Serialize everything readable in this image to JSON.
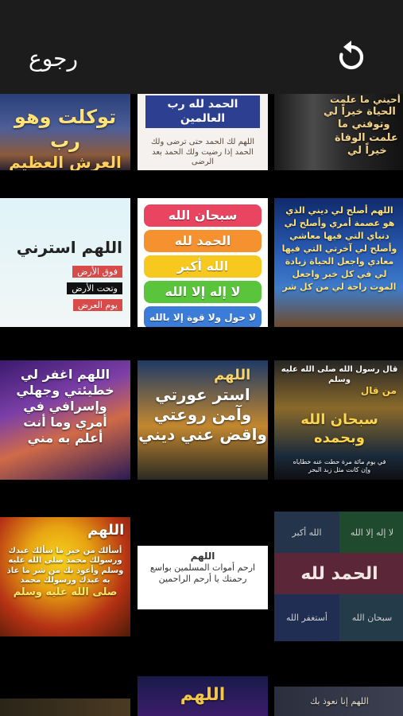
{
  "header": {
    "back_label": "رجوع",
    "refresh_icon": "refresh-icon"
  },
  "tiles": {
    "r0c0": {
      "line1": "توكلت وهو رب",
      "line2": "العرش العظيم"
    },
    "r0c1": {
      "title": "الحمد لله رب العالمين",
      "body": "اللهم لك الحمد حتى ترضى ولك الحمد إذا رضيت ولك الحمد بعد الرضى"
    },
    "r0c2": {
      "line1": "أحيني ما علمت",
      "line2": "الحياة خيراً لي",
      "line3": "وتوفني ما",
      "line4": "علمت الوفاة",
      "line5": "خيراً لي"
    },
    "r1c0": {
      "title": "اللهم استرني",
      "l1": "فوق الأرض",
      "l2": "وتحت الأرض",
      "l3": "يوم العرض"
    },
    "r1c1": {
      "p1": "سبحان الله",
      "p2": "الحمد لله",
      "p3": "الله أكبر",
      "p4": "لا إله إلا الله",
      "p5": "لا حول ولا قوة إلا بالله"
    },
    "r1c2": {
      "body": "اللهم أصلح لي ديني الذي هو عصمة أمري وأصلح لي دنياي التي فيها معاشي وأصلح لي آخرتي التي فيها معادي واجعل الحياة زيادة لي في كل خير واجعل الموت راحة لي من كل شر"
    },
    "r2c0": {
      "l1": "اللهم اغفر لي",
      "l2": "خطيئتي وجهلي",
      "l3": "وإسرافي في",
      "l4": "أمري وما أنت",
      "l5": "أعلم به مني"
    },
    "r2c1": {
      "l0": "اللهم",
      "l1": "استر عورتي",
      "l2": "وآمن روعتي",
      "l3": "واقض عني ديني"
    },
    "r2c2": {
      "l1": "قال رسول الله صلى الله عليه وسلم",
      "l2": "من قال",
      "l3": "سبحان الله وبحمده",
      "l4": "في يوم مائة مرة حطت عنه خطاياه",
      "l5": "وإن كانت مثل زبد البحر"
    },
    "r3c0": {
      "l0": "اللهم",
      "l1": "أسألك من خير ما سألك عبدك",
      "l2": "ورسولك محمد صلى الله عليه",
      "l3": "وسلم وأعوذ بك من شر ما عاذ",
      "l4": "به عبدك ورسولك محمد",
      "l5": "صلى الله عليه وسلم"
    },
    "r3c1": {
      "l1": "اللهم",
      "l2": "ارحم أموات المسلمين بواسع",
      "l3": "رحمتك يا أرحم الراحمين"
    },
    "r3c2": {
      "c1": "لا إله إلا الله",
      "c2": "الله أكبر",
      "c3": "الحمد لله",
      "c4": "سبحان الله",
      "c5": "أستغفر الله"
    },
    "r4c1": {
      "l1": "اللهم"
    },
    "r4c2": {
      "l1": "اللهم إنا نعوذ بك"
    }
  },
  "colors": {
    "topbar": "#1c1c1c",
    "background": "#000000"
  }
}
